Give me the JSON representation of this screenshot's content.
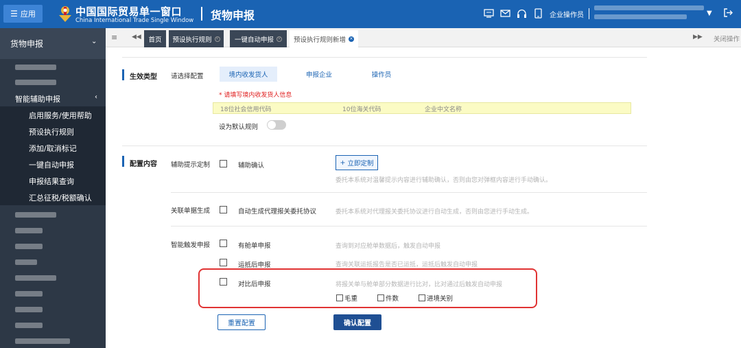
{
  "header": {
    "app_label": "应用",
    "brand_cn": "中国国际贸易单一窗口",
    "brand_en": "China International Trade Single Window",
    "page_title": "货物申报",
    "user_role": "企业操作员",
    "accent": "#1a63b3"
  },
  "sidebar": {
    "top_label": "货物申报",
    "section_label": "智能辅助申报",
    "sub_items": [
      {
        "label": "启用服务/使用帮助"
      },
      {
        "label": "预设执行规则"
      },
      {
        "label": "添加/取消标记"
      },
      {
        "label": "一键自动申报"
      },
      {
        "label": "申报结果查询"
      },
      {
        "label": "汇总征税/税额确认"
      }
    ]
  },
  "tabs": {
    "items": [
      {
        "label": "首页"
      },
      {
        "label": "预设执行规则"
      },
      {
        "label": "一键自动申报"
      },
      {
        "label": "预设执行规则新增"
      }
    ],
    "close_all": "关闭操作"
  },
  "form": {
    "effect_section": "生效类型",
    "select_config_label": "请选择配置",
    "options": [
      "境内收发货人",
      "申报企业",
      "操作员"
    ],
    "warning": "* 请填写境内收发货人信息",
    "placeholders": [
      "18位社会信用代码",
      "10位海关代码",
      "企业中文名称"
    ],
    "default_rule_label": "设为默认规则",
    "config_section": "配置内容",
    "assist_prompt_label": "辅助提示定制",
    "assist_confirm_label": "辅助确认",
    "custom_button": "立即定制",
    "assist_desc": "委托本系统对温馨提示内容进行辅助确认，否则由您对弹框内容进行手动确认。",
    "linked_doc_label": "关联单据生成",
    "auto_gen_label": "自动生成代理报关委托协议",
    "auto_gen_desc": "委托本系统对代理报关委托协议进行自动生成，否则由您进行手动生成。",
    "smart_trigger_label": "智能触发申报",
    "manifest_label": "有舱单申报",
    "manifest_desc": "查询到对应舱单数据后，触发自动申报",
    "arrival_label": "运抵后申报",
    "arrival_desc": "查询关联运抵报告是否已运抵，运抵后触发自动申报",
    "compare_label": "对比后申报",
    "compare_desc": "将报关单与舱单部分数据进行比对，比对通过后触发自动申报",
    "compare_options": [
      "毛重",
      "件数",
      "进境关别"
    ],
    "reset_button": "重置配置",
    "confirm_button": "确认配置"
  }
}
